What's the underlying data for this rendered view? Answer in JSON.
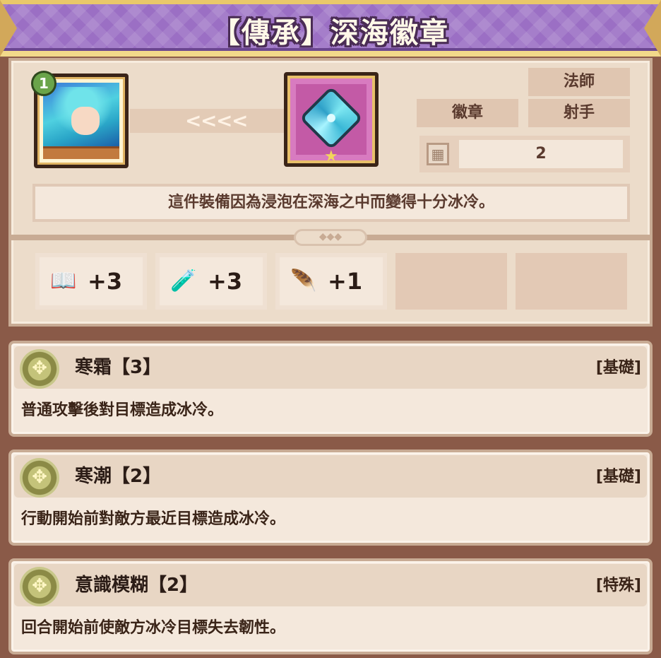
{
  "title": "【傳承】深海徽章",
  "hero": {
    "level": "1"
  },
  "emblem": {
    "icon": "ice-gem-icon"
  },
  "tags": {
    "class_top": "法師",
    "category": "徽章",
    "class_bottom": "射手"
  },
  "count": {
    "icon": "slot-grid-icon",
    "value": "2"
  },
  "description": "這件裝備因為浸泡在深海之中而變得十分冰冷。",
  "stats": [
    {
      "icon": "book-icon",
      "value": "+3"
    },
    {
      "icon": "potion-icon",
      "value": "+3"
    },
    {
      "icon": "feather-icon",
      "value": "+1"
    }
  ],
  "skills": [
    {
      "name": "寒霜【3】",
      "type": "[基礎]",
      "desc": "普通攻擊後對目標造成冰冷。"
    },
    {
      "name": "寒潮【2】",
      "type": "[基礎]",
      "desc": "行動開始前對敵方最近目標造成冰冷。"
    },
    {
      "name": "意識模糊【2】",
      "type": "[特殊]",
      "desc": "回合開始前使敵方冰冷目標失去韌性。"
    }
  ]
}
